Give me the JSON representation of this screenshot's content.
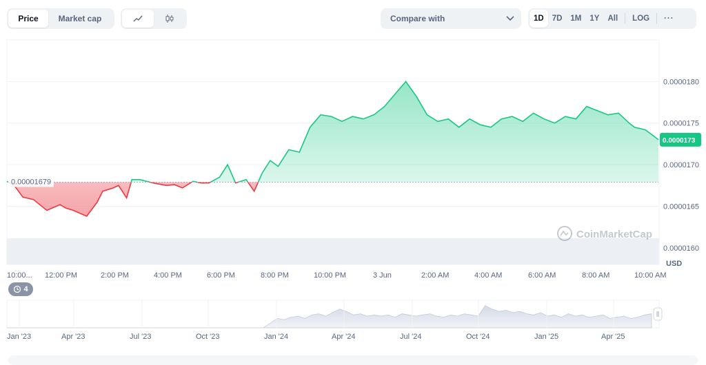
{
  "toolbar": {
    "view_tabs": [
      "Price",
      "Market cap"
    ],
    "active_view": "Price",
    "chart_type_icons": [
      "line-chart-icon",
      "candlestick-icon"
    ],
    "compare_label": "Compare with",
    "ranges": [
      "1D",
      "7D",
      "1M",
      "1Y",
      "All"
    ],
    "active_range": "1D",
    "log_label": "LOG",
    "more_label": "···"
  },
  "chart_data": {
    "type": "area",
    "currency": "USD",
    "y_ticks": [
      "0.0000180",
      "0.0000175",
      "0.0000170",
      "0.0000165",
      "0.0000160"
    ],
    "ylim": [
      1.58e-05,
      1.85e-05
    ],
    "x_ticks": [
      "10:00...",
      "12:00 PM",
      "2:00 PM",
      "4:00 PM",
      "6:00 PM",
      "8:00 PM",
      "10:00 PM",
      "3 Jun",
      "2:00 AM",
      "4:00 AM",
      "6:00 AM",
      "8:00 AM",
      "10:00 AM"
    ],
    "baseline_price": 1.679e-05,
    "baseline_label": "0.00001679",
    "current_price": 1.73e-05,
    "current_label": "0.0000173",
    "x_hours": [
      0,
      0.3,
      0.6,
      1.0,
      1.5,
      2.0,
      2.2,
      2.5,
      3.0,
      3.4,
      3.6,
      4.0,
      4.2,
      4.5,
      4.7,
      5.0,
      5.5,
      6.0,
      6.3,
      6.6,
      7.0,
      7.3,
      7.6,
      8.0,
      8.3,
      8.6,
      9.0,
      9.3,
      9.6,
      9.9,
      10.2,
      10.6,
      11.0,
      11.4,
      11.8,
      12.2,
      12.6,
      13.0,
      13.4,
      13.8,
      14.2,
      14.6,
      15.0,
      15.4,
      15.8,
      16.2,
      16.6,
      17.0,
      17.4,
      17.8,
      18.2,
      18.6,
      19.0,
      19.4,
      19.8,
      20.2,
      20.6,
      21.0,
      21.4,
      21.8,
      22.2,
      22.6,
      23.0,
      23.4,
      23.6,
      24.0,
      24.3,
      24.5
    ],
    "values": [
      1.68e-05,
      1.674e-05,
      1.661e-05,
      1.658e-05,
      1.645e-05,
      1.652e-05,
      1.648e-05,
      1.645e-05,
      1.638e-05,
      1.655e-05,
      1.668e-05,
      1.672e-05,
      1.675e-05,
      1.66e-05,
      1.682e-05,
      1.682e-05,
      1.678e-05,
      1.675e-05,
      1.676e-05,
      1.672e-05,
      1.68e-05,
      1.678e-05,
      1.678e-05,
      1.685e-05,
      1.7e-05,
      1.678e-05,
      1.682e-05,
      1.668e-05,
      1.69e-05,
      1.705e-05,
      1.698e-05,
      1.718e-05,
      1.715e-05,
      1.745e-05,
      1.76e-05,
      1.758e-05,
      1.752e-05,
      1.758e-05,
      1.755e-05,
      1.76e-05,
      1.77e-05,
      1.785e-05,
      1.8e-05,
      1.782e-05,
      1.76e-05,
      1.752e-05,
      1.755e-05,
      1.745e-05,
      1.755e-05,
      1.748e-05,
      1.745e-05,
      1.755e-05,
      1.758e-05,
      1.752e-05,
      1.762e-05,
      1.755e-05,
      1.75e-05,
      1.758e-05,
      1.755e-05,
      1.77e-05,
      1.765e-05,
      1.76e-05,
      1.762e-05,
      1.75e-05,
      1.745e-05,
      1.742e-05,
      1.735e-05,
      1.73e-05
    ],
    "overview_x_ticks": [
      "Jan '23",
      "Apr '23",
      "Jul '23",
      "Oct '23",
      "Jan '24",
      "Apr '24",
      "Jul '24",
      "Oct '24",
      "Jan '25",
      "Apr '25"
    ]
  },
  "watermark": "CoinMarketCap",
  "events_badge": "4",
  "colors": {
    "up": "#16c784",
    "down": "#ea3943",
    "up_fill": "#16c784",
    "down_fill": "#ea3943",
    "axis": "#58667e",
    "grid": "#eff2f5",
    "overview_fill": "#cfd6e4"
  }
}
